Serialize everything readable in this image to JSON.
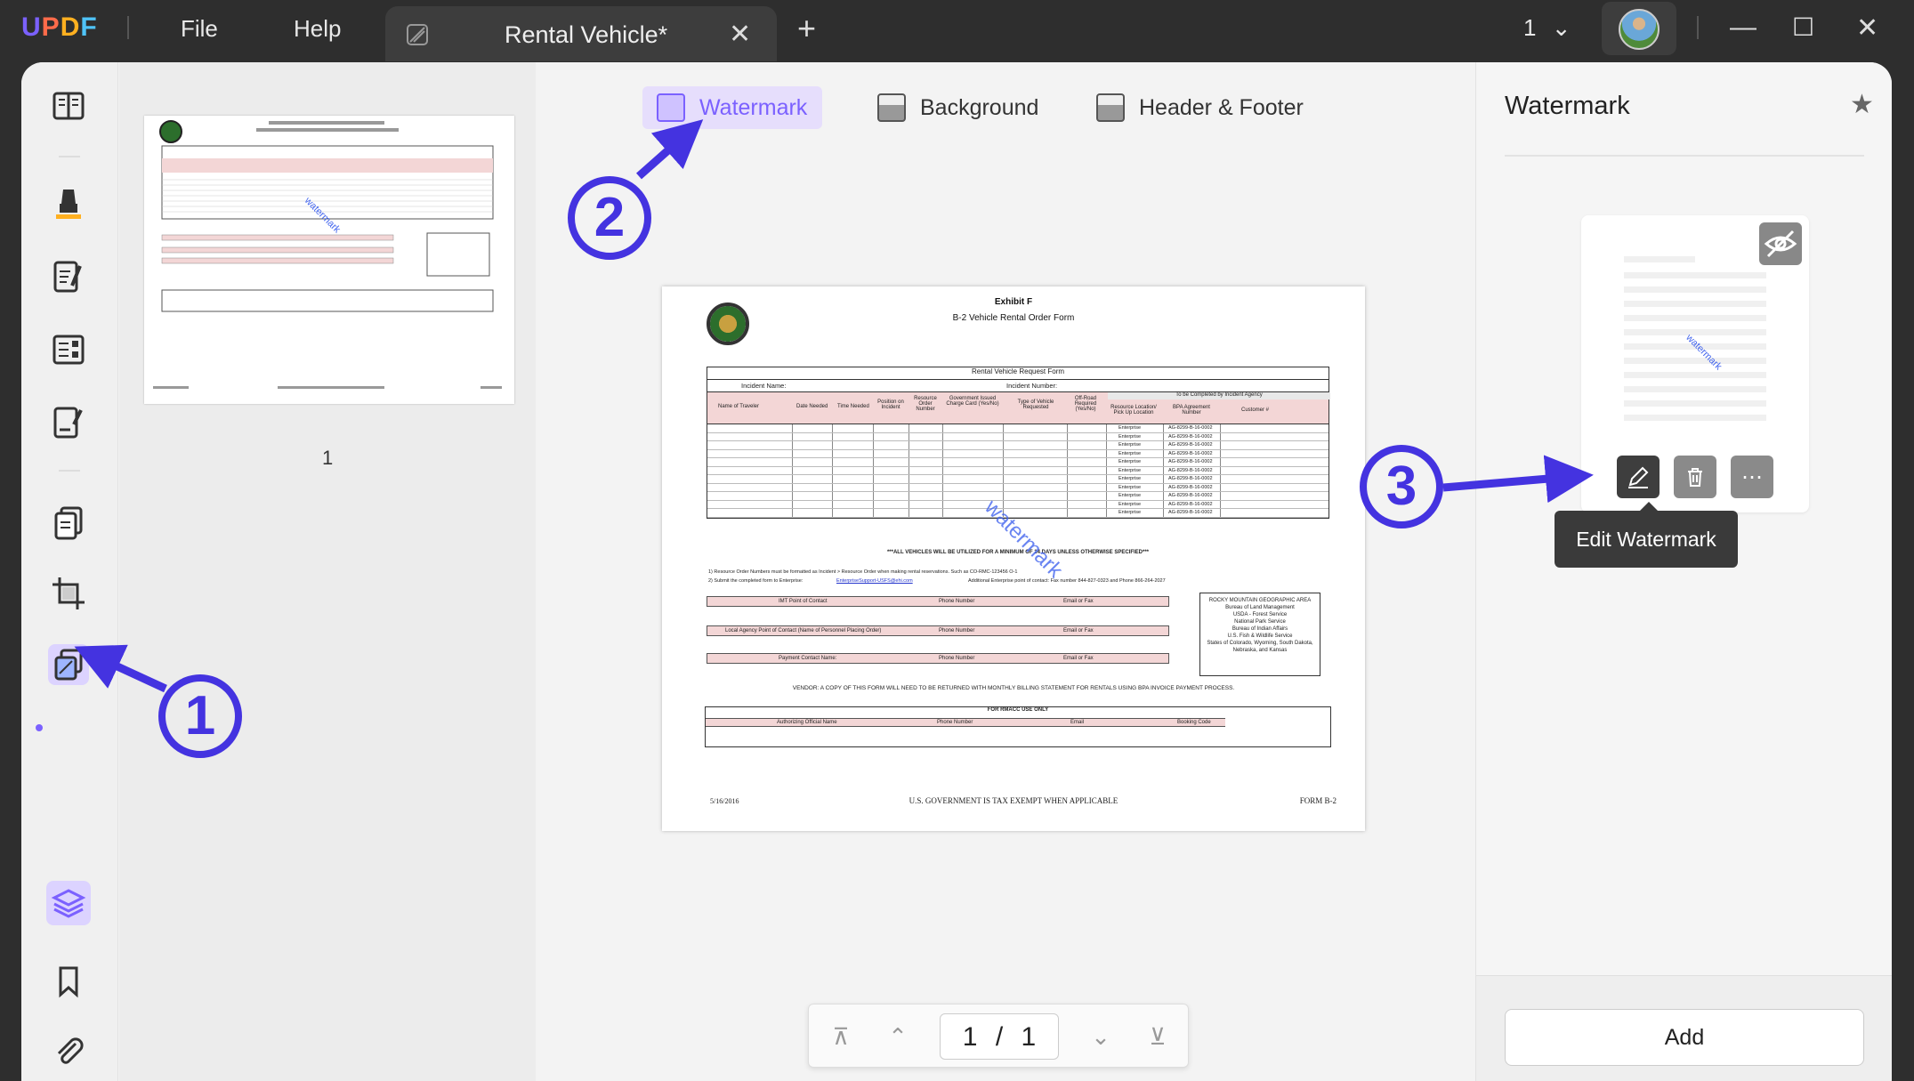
{
  "app": {
    "logo": [
      "U",
      "P",
      "D",
      "F"
    ],
    "menu": [
      "File",
      "Help"
    ],
    "tab_title": "Rental Vehicle*",
    "tab_close": "✕",
    "new_tab": "+",
    "page_indicator": "1",
    "window_controls": [
      "—",
      "☐",
      "✕"
    ]
  },
  "thumbnail": {
    "page_number": "1"
  },
  "toolbar": {
    "watermark_label": "Watermark",
    "background_label": "Background",
    "header_footer_label": "Header & Footer",
    "active": "watermark"
  },
  "document": {
    "exhibit": "Exhibit F",
    "form_title": "B-2 Vehicle Rental Order Form",
    "table_title": "Rental Vehicle Request Form",
    "incident_name": "Incident Name:",
    "incident_number": "Incident Number:",
    "to_be_completed": "To be Completed by Incident Agency",
    "columns": [
      "Name of Traveler",
      "Date Needed",
      "Time Needed",
      "Position on Incident",
      "Resource Order Number",
      "Government Issued Charge Card (Yes/No)",
      "Type of Vehicle Requested",
      "Off-Road Required (Yes/No)",
      "Resource Location/ Pick Up Location",
      "BPA Agreement Number",
      "Customer #"
    ],
    "row_location": "Enterprise",
    "row_bpa": "AG-8299-B-16-0002",
    "row_count": 11,
    "note": "***ALL VEHICLES WILL BE UTILIZED FOR A MINIMUM OF 14 DAYS UNLESS OTHERWISE SPECIFIED***",
    "instruction_1": "1) Resource Order Numbers must be formatted as Incident > Resource Order when making rental reservations. Such as CO-RMC-123456 O-1",
    "instruction_2": "2) Submit the completed form to Enterprise:",
    "email": "EnterpriseSupport-USFS@ehi.com",
    "additional_contact": "Additional Enterprise point of contact:  Fax number 844-827-0323 and Phone 866-264-2027",
    "contact_rows": [
      "IMT Point of Contact",
      "Local Agency Point of Contact (Name of Personnel Placing Order)",
      "Payment Contact Name:"
    ],
    "phone_label": "Phone Number",
    "email_label": "Email or Fax",
    "rmg": [
      "ROCKY MOUNTAIN GEOGRAPHIC AREA",
      "Bureau of Land Management",
      "USDA - Forest Service",
      "National Park Service",
      "Bureau of Indian Affairs",
      "U.S. Fish & Wildlife Service",
      "States of Colorado, Wyoming, South Dakota, Nebraska, and Kansas"
    ],
    "vendor_note": "VENDOR: A COPY OF THIS FORM WILL NEED TO BE RETURNED WITH MONTHLY BILLING STATEMENT FOR RENTALS USING BPA INVOICE PAYMENT PROCESS.",
    "rmacc_title": "FOR RMACC USE ONLY",
    "rmacc_cols": [
      "Authorizing Official Name",
      "Phone Number",
      "Email",
      "Booking Code"
    ],
    "footer_date": "5/16/2016",
    "footer_center": "U.S. GOVERNMENT IS TAX EXEMPT WHEN APPLICABLE",
    "footer_right": "FORM B-2",
    "watermark_text": "watermark"
  },
  "pager": {
    "current": "1",
    "separator": "/",
    "total": "1"
  },
  "right_panel": {
    "title": "Watermark",
    "card_watermark": "watermark",
    "tooltip": "Edit Watermark",
    "add_label": "Add"
  },
  "annotations": {
    "step1": "1",
    "step2": "2",
    "step3": "3"
  },
  "colors": {
    "accent": "#7b61ff",
    "annotation": "#4433e0",
    "watermark": "#4466ee"
  }
}
